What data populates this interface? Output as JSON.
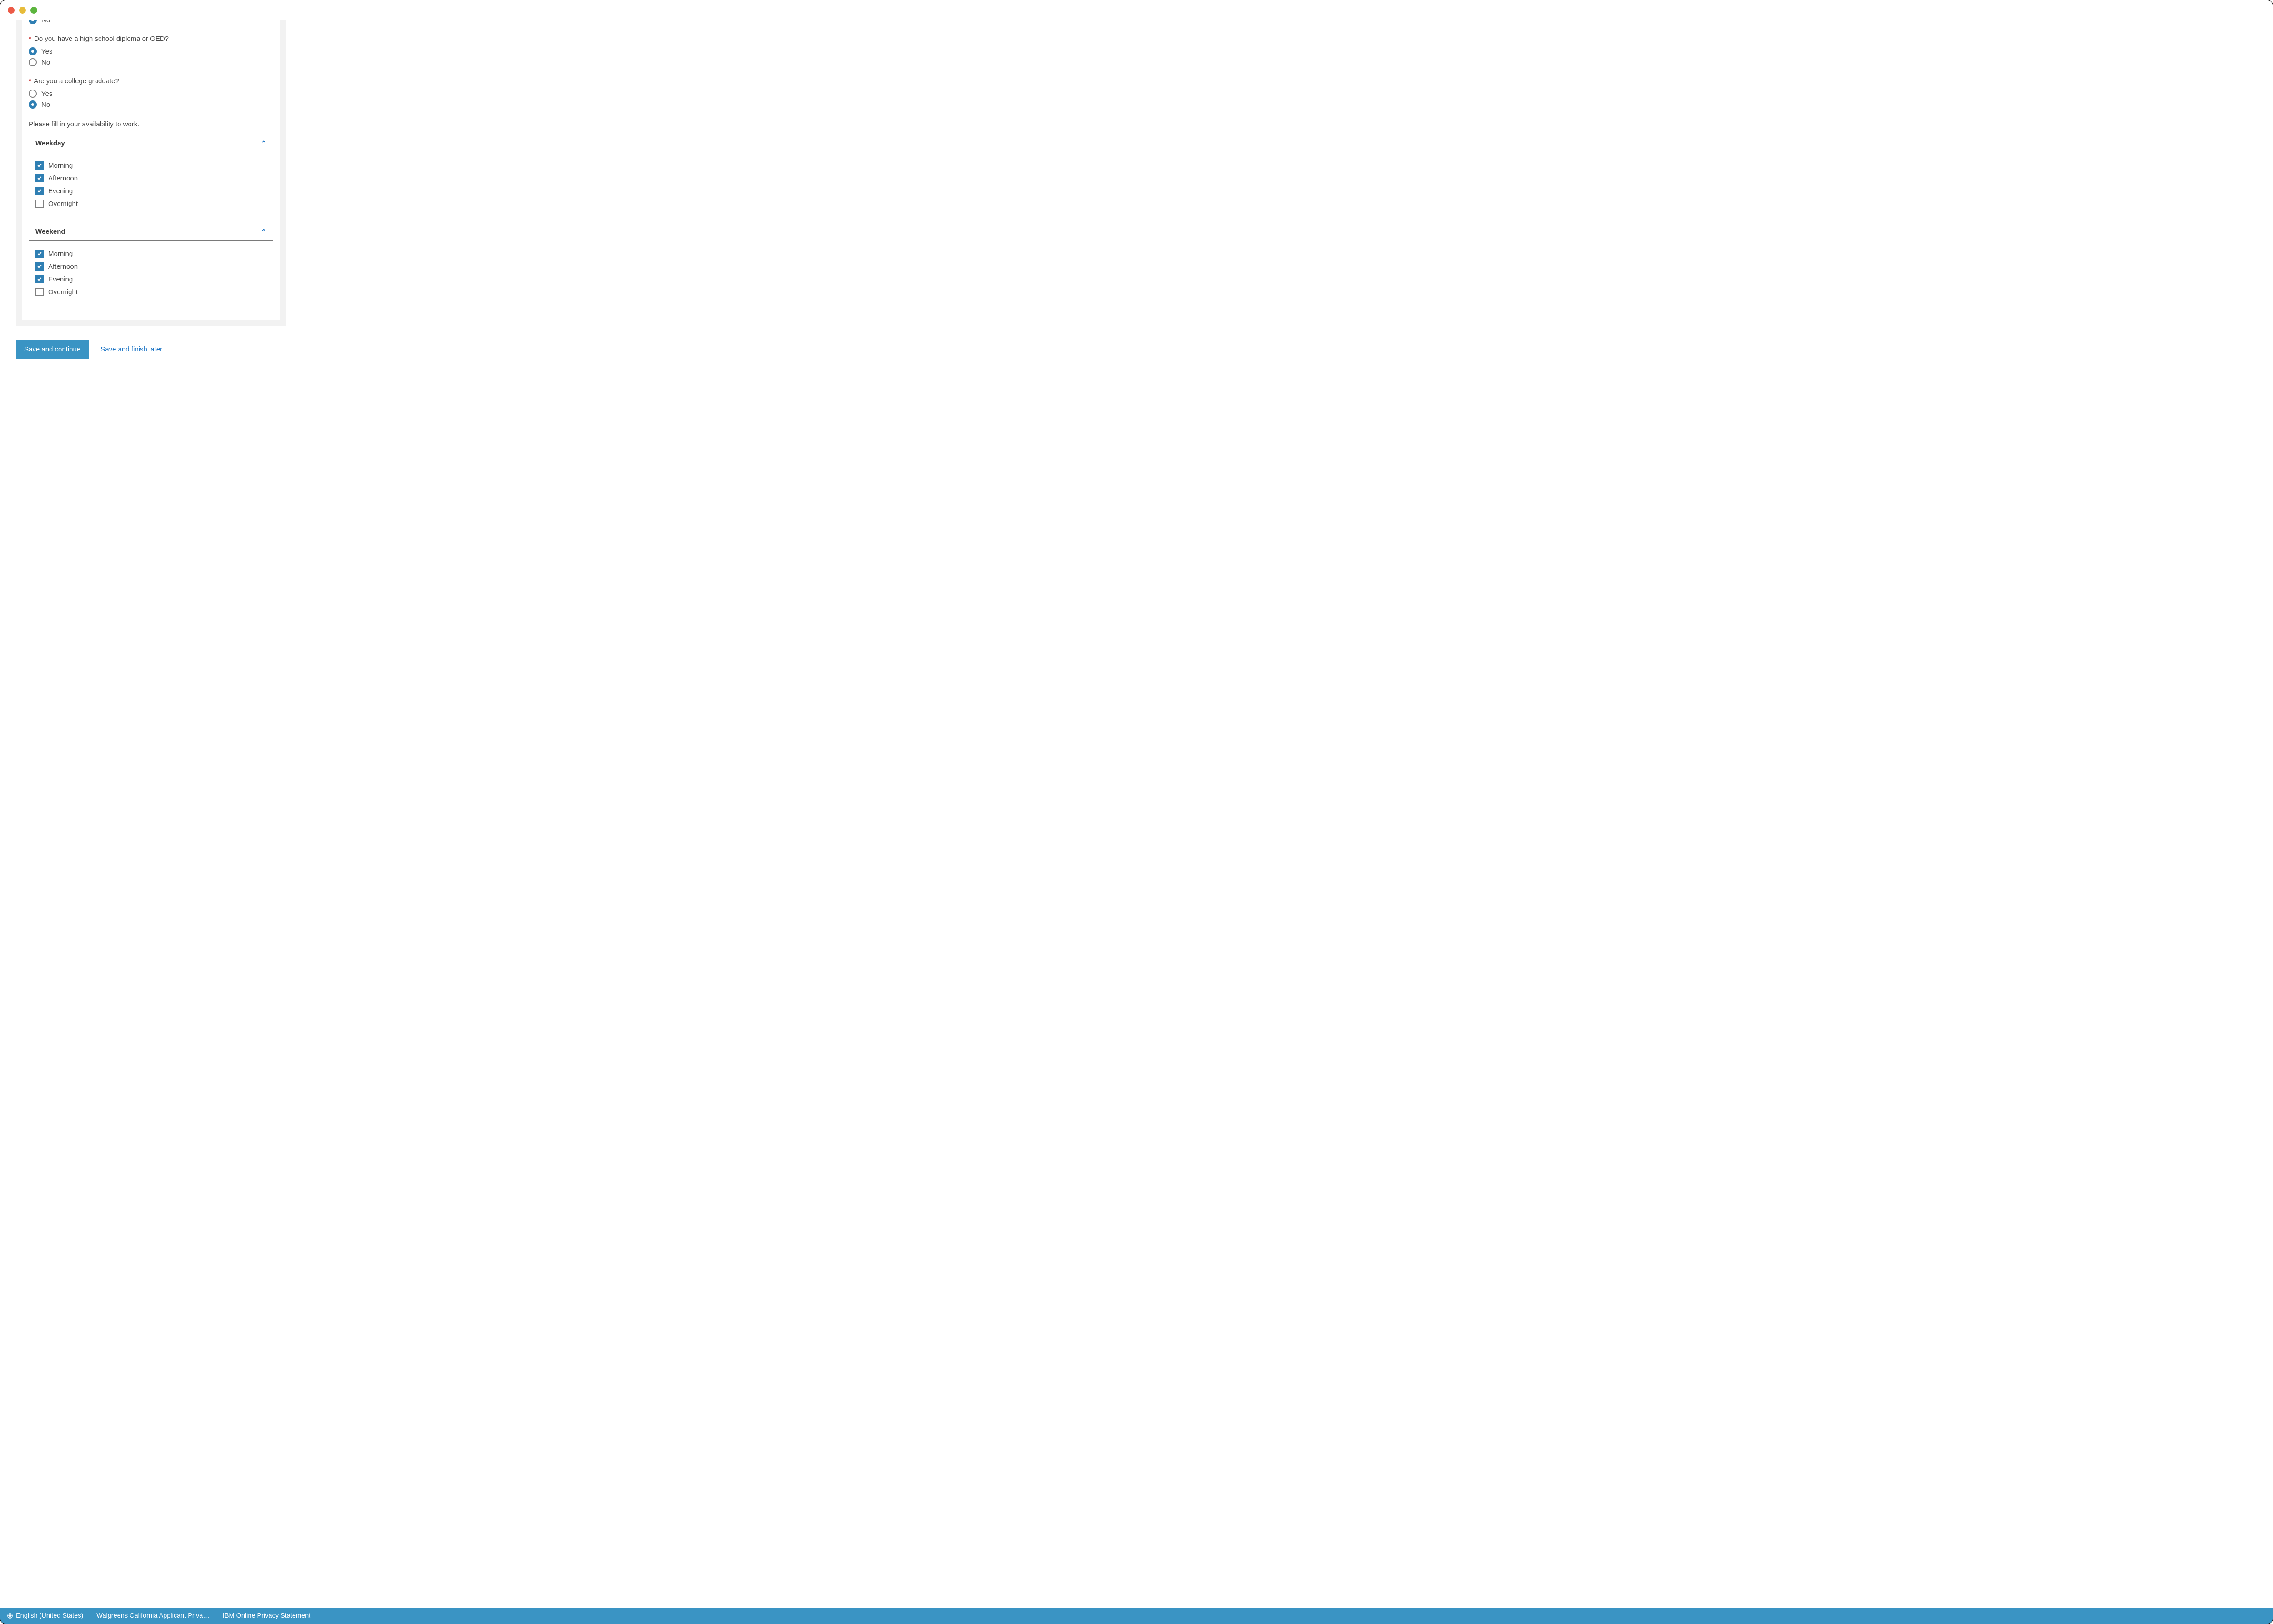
{
  "clipped_radio": {
    "label": "No",
    "checked": true
  },
  "questions": [
    {
      "label": "Do you have a high school diploma or GED?",
      "required": true,
      "options": [
        {
          "label": "Yes",
          "checked": true
        },
        {
          "label": "No",
          "checked": false
        }
      ]
    },
    {
      "label": "Are you a college graduate?",
      "required": true,
      "options": [
        {
          "label": "Yes",
          "checked": false
        },
        {
          "label": "No",
          "checked": true
        }
      ]
    }
  ],
  "availability_instruction": "Please fill in your availability to work.",
  "availability": [
    {
      "title": "Weekday",
      "expanded": true,
      "items": [
        {
          "label": "Morning",
          "checked": true
        },
        {
          "label": "Afternoon",
          "checked": true
        },
        {
          "label": "Evening",
          "checked": true
        },
        {
          "label": "Overnight",
          "checked": false
        }
      ]
    },
    {
      "title": "Weekend",
      "expanded": true,
      "items": [
        {
          "label": "Morning",
          "checked": true
        },
        {
          "label": "Afternoon",
          "checked": true
        },
        {
          "label": "Evening",
          "checked": true
        },
        {
          "label": "Overnight",
          "checked": false
        }
      ]
    }
  ],
  "buttons": {
    "save_continue": "Save and continue",
    "save_later": "Save and finish later"
  },
  "footer": {
    "language": "English (United States)",
    "link1": "Walgreens California Applicant Priva…",
    "link2": "IBM Online Privacy Statement"
  }
}
